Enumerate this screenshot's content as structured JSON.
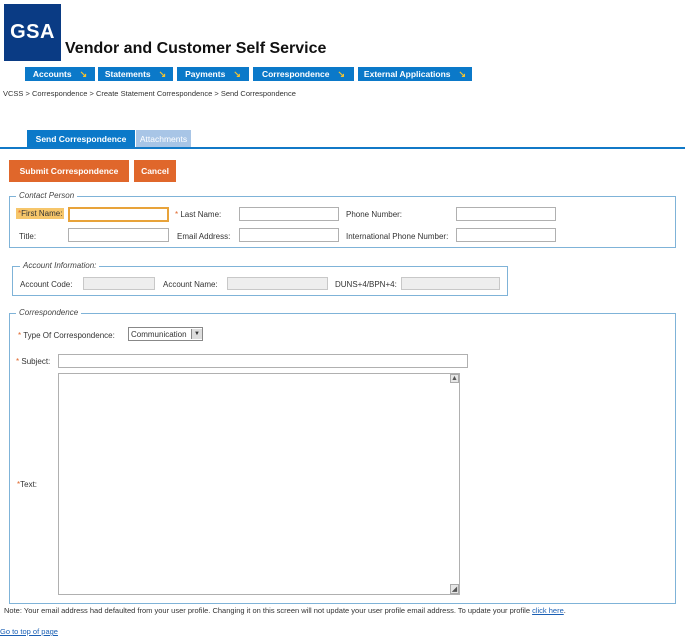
{
  "header": {
    "logo_text": "GSA",
    "app_title": "Vendor and Customer Self Service"
  },
  "nav": [
    {
      "label": "Accounts"
    },
    {
      "label": "Statements"
    },
    {
      "label": "Payments"
    },
    {
      "label": "Correspondence"
    },
    {
      "label": "External Applications"
    }
  ],
  "breadcrumb": "VCSS > Correspondence > Create Statement Correspondence > Send Correspondence",
  "tabs": {
    "send": "Send Correspondence",
    "attachments": "Attachments"
  },
  "actions": {
    "submit": "Submit Correspondence",
    "cancel": "Cancel"
  },
  "contact": {
    "legend": "Contact Person",
    "first_name": "First Name:",
    "last_name": "Last Name:",
    "phone": "Phone Number:",
    "title": "Title:",
    "email": "Email Address:",
    "intl_phone": "International Phone Number:"
  },
  "account": {
    "legend": "Account Information:",
    "code": "Account Code:",
    "name": "Account Name:",
    "duns": "DUNS+4/BPN+4:"
  },
  "correspondence": {
    "legend": "Correspondence",
    "type_label": "Type Of Correspondence:",
    "type_value": "Communication",
    "subject": "Subject:",
    "text": "Text:"
  },
  "note": {
    "text": "Note: Your email address had defaulted from your user profile. Changing it on this screen will not update your user profile email address. To update your profile ",
    "link": "click here",
    "end": "."
  },
  "go_top": "Go to top of page",
  "colors": {
    "brand_blue": "#0b79c9",
    "action_orange": "#e0672b",
    "required": "#e0672b"
  }
}
